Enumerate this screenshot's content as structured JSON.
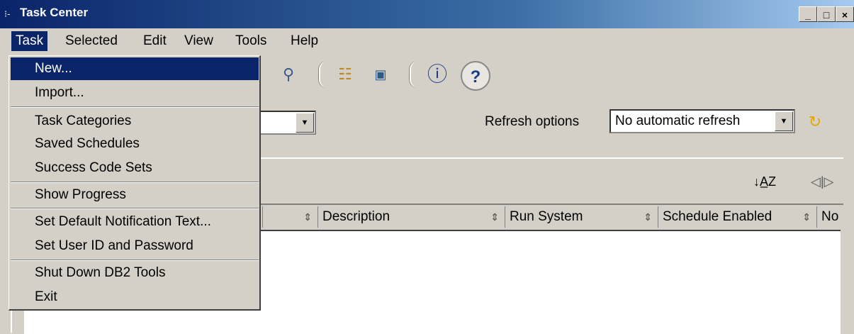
{
  "window": {
    "title": "Task Center",
    "icon": "app-icon",
    "controls": {
      "minimize": "_",
      "maximize": "□",
      "close": "×"
    }
  },
  "menubar": {
    "items": [
      "Task",
      "Selected",
      "Edit",
      "View",
      "Tools",
      "Help"
    ],
    "active": "Task"
  },
  "toolbar": {
    "icons": [
      "task-link-icon",
      "contacts-icon",
      "schedule-icon",
      "info-icon",
      "help-icon"
    ]
  },
  "filter": {
    "refresh_label": "Refresh options",
    "refresh_value": "No automatic refresh"
  },
  "table": {
    "sort_icon": "sort-az-icon",
    "columns_icon": "column-settings-icon",
    "columns": [
      "Description",
      "Run System",
      "Schedule Enabled",
      "No"
    ]
  },
  "task_menu": {
    "items": [
      "New...",
      "Import...",
      "Task Categories",
      "Saved Schedules",
      "Success Code Sets",
      "Show Progress",
      "Set Default Notification Text...",
      "Set User ID and Password",
      "Shut Down DB2 Tools",
      "Exit"
    ],
    "highlighted": "New..."
  }
}
